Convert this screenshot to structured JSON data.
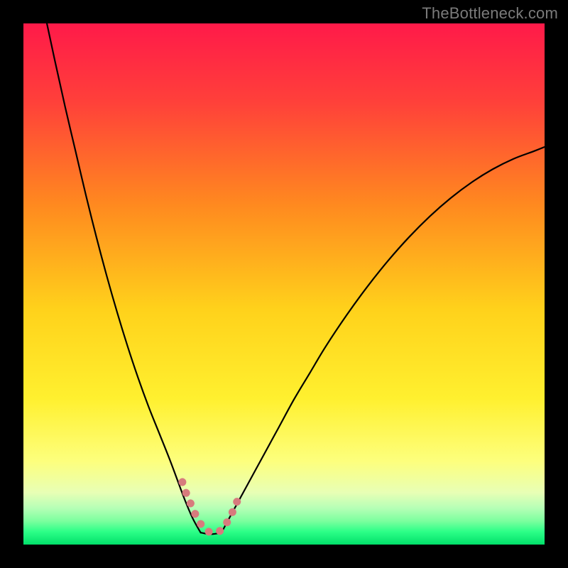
{
  "watermark": "TheBottleneck.com",
  "chart_data": {
    "type": "line",
    "title": "",
    "xlabel": "",
    "ylabel": "",
    "xlim": [
      0,
      100
    ],
    "ylim": [
      0,
      100
    ],
    "grid": false,
    "background": {
      "type": "vertical-gradient",
      "stops": [
        {
          "offset": 0.0,
          "color": "#ff1a49"
        },
        {
          "offset": 0.15,
          "color": "#ff403a"
        },
        {
          "offset": 0.35,
          "color": "#ff8a1f"
        },
        {
          "offset": 0.55,
          "color": "#ffd21b"
        },
        {
          "offset": 0.72,
          "color": "#fff02f"
        },
        {
          "offset": 0.84,
          "color": "#fdff7d"
        },
        {
          "offset": 0.9,
          "color": "#e8ffb5"
        },
        {
          "offset": 0.93,
          "color": "#b6ffb6"
        },
        {
          "offset": 0.955,
          "color": "#7bff9e"
        },
        {
          "offset": 0.975,
          "color": "#2dff88"
        },
        {
          "offset": 1.0,
          "color": "#01e06a"
        }
      ]
    },
    "series": [
      {
        "name": "curve-left",
        "stroke": "#000000",
        "stroke_width": 2.2,
        "x": [
          4.5,
          6,
          8,
          10,
          12,
          14,
          16,
          18,
          20,
          22,
          24,
          26,
          28,
          29.5,
          31,
          32.5,
          34
        ],
        "y": [
          100,
          93,
          84,
          75.5,
          67,
          59,
          51.5,
          44.5,
          38,
          32,
          26.5,
          21.5,
          16.5,
          12.5,
          8.5,
          5,
          2.3
        ]
      },
      {
        "name": "curve-right",
        "stroke": "#000000",
        "stroke_width": 2.2,
        "x": [
          38,
          40,
          43,
          46,
          49,
          52,
          55,
          58,
          62,
          66,
          70,
          74,
          78,
          82,
          86,
          90,
          94,
          98,
          100
        ],
        "y": [
          2.3,
          6,
          11.5,
          17,
          22.5,
          28,
          33,
          38,
          44,
          49.5,
          54.5,
          59,
          63,
          66.5,
          69.5,
          72,
          74,
          75.5,
          76.3
        ]
      },
      {
        "name": "bottom-flat",
        "stroke": "#000000",
        "stroke_width": 2.2,
        "x": [
          34,
          35,
          36,
          37,
          38
        ],
        "y": [
          2.3,
          2.1,
          2.0,
          2.1,
          2.3
        ]
      }
    ],
    "highlight": {
      "name": "sweet-spot-band",
      "stroke": "#d77b7d",
      "stroke_width": 11,
      "linecap": "round",
      "segments": [
        {
          "x": [
            30.5,
            31.3,
            32.2,
            33.0,
            33.8,
            34.6,
            35.5,
            36.5,
            37.5,
            38.4,
            39.2,
            40.0,
            40.8,
            41.6
          ],
          "y": [
            12.0,
            9.7,
            7.6,
            5.8,
            4.3,
            3.2,
            2.5,
            2.3,
            2.5,
            3.3,
            4.5,
            6.0,
            7.8,
            9.8
          ]
        }
      ]
    }
  }
}
